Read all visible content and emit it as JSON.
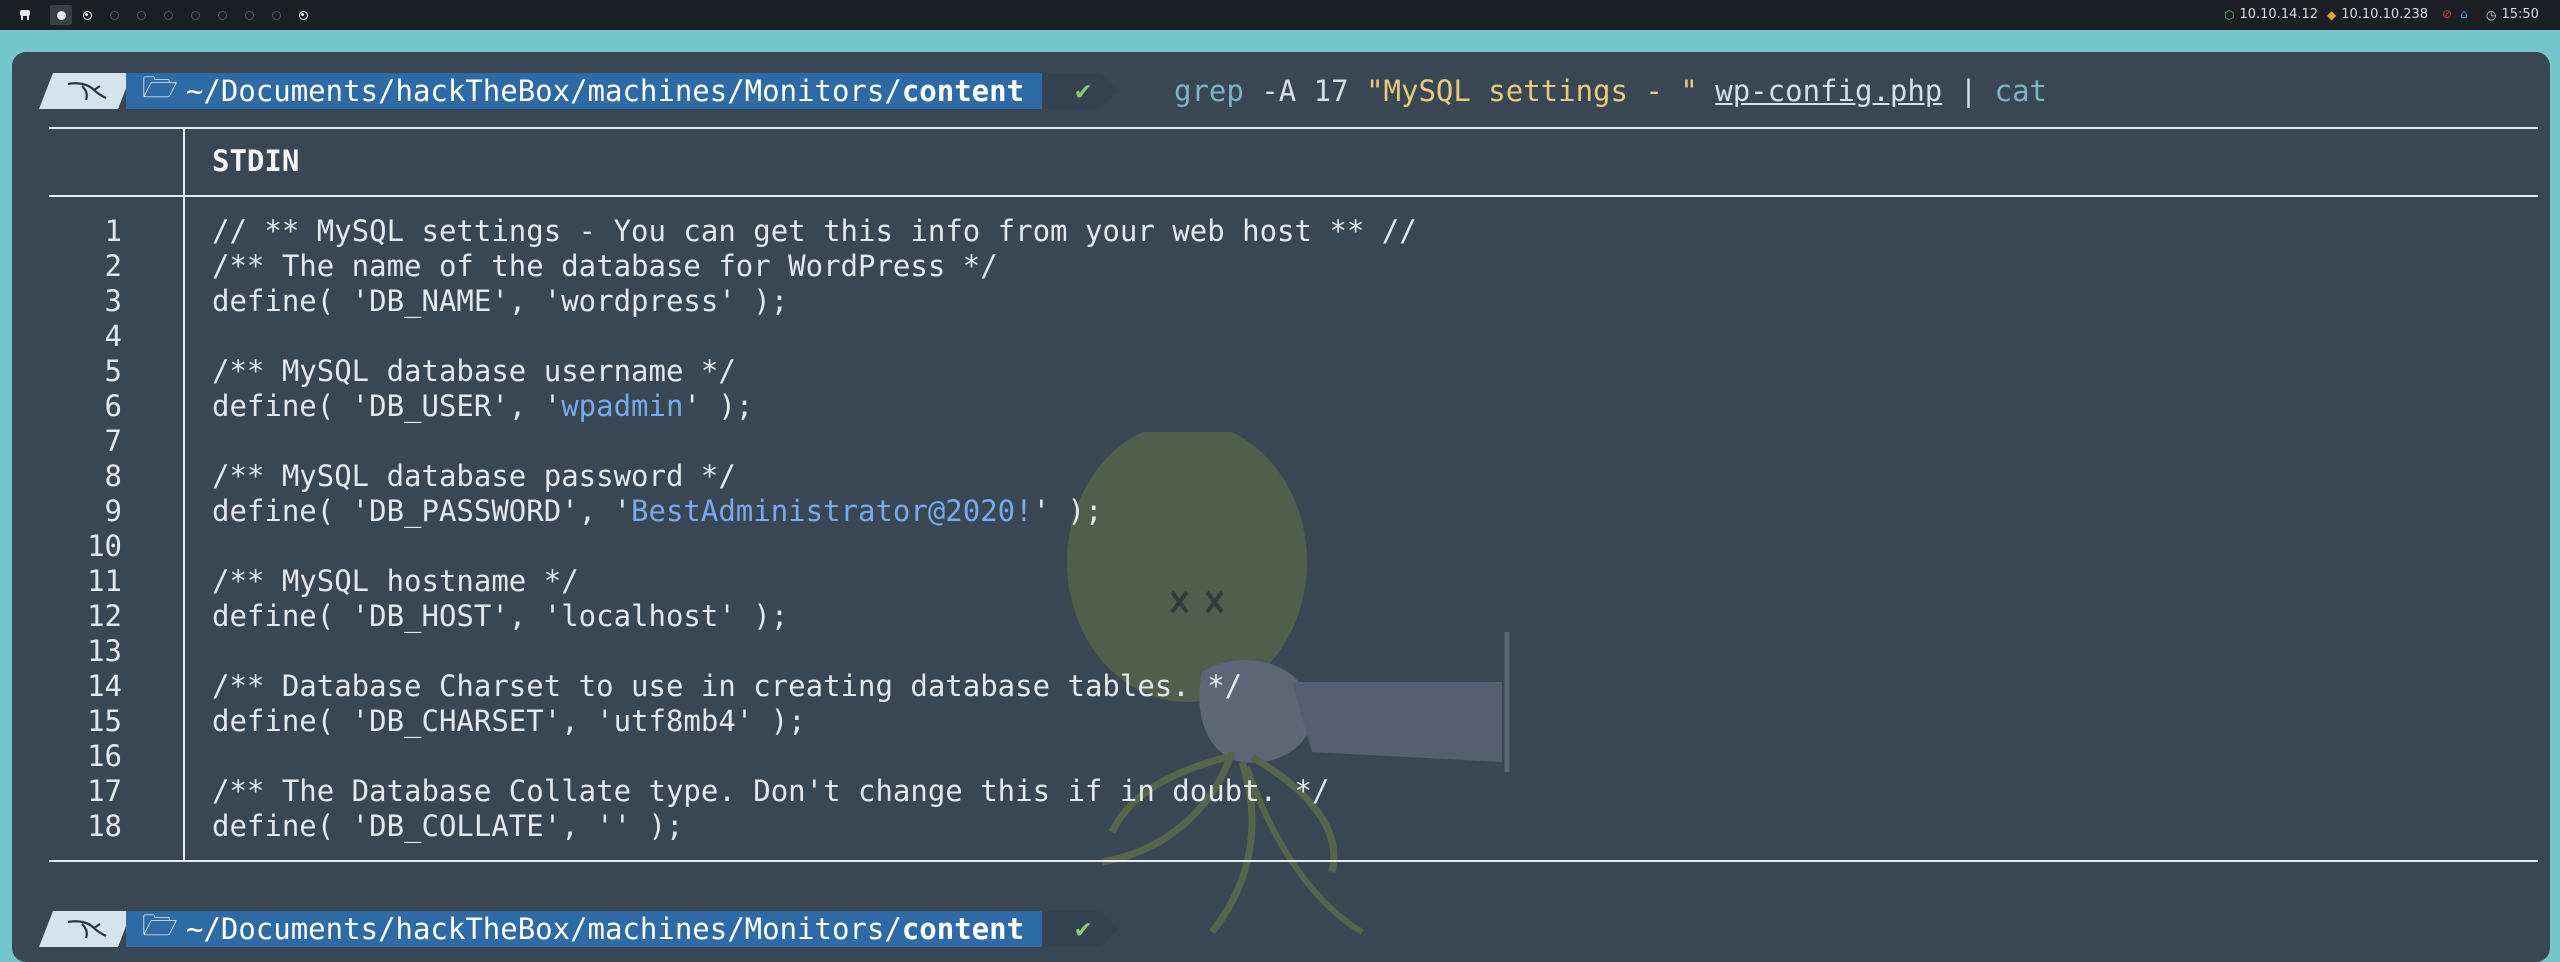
{
  "topbar": {
    "workspaces": [
      {
        "state": "active-full"
      },
      {
        "state": "ring-dot"
      },
      {
        "state": "empty"
      },
      {
        "state": "empty"
      },
      {
        "state": "empty"
      },
      {
        "state": "empty"
      },
      {
        "state": "empty"
      },
      {
        "state": "empty"
      },
      {
        "state": "empty"
      },
      {
        "state": "ring-dot"
      }
    ],
    "vpn_ip": "10.10.14.12",
    "target_ip": "10.10.10.238",
    "time": "15:50",
    "colors": {
      "vpn": "#48c774",
      "target": "#f0a020",
      "alert": "#e04040",
      "home": "#3b8fe0"
    }
  },
  "prompt": {
    "path_prefix": "~/Documents/hackTheBox/machines/Monitors/",
    "path_current": "content",
    "status_icon": "✔"
  },
  "command": {
    "cmd": "grep",
    "flag": " -A 17 ",
    "pattern": "\"MySQL settings - \"",
    "file": "wp-config.php",
    "pipe": " | ",
    "pipe_cmd": "cat"
  },
  "output": {
    "header": "STDIN",
    "lines": [
      {
        "n": "1",
        "text": "// ** MySQL settings - You can get this info from your web host ** //"
      },
      {
        "n": "2",
        "text": "/** The name of the database for WordPress */"
      },
      {
        "n": "3",
        "text": "define( 'DB_NAME', 'wordpress' );"
      },
      {
        "n": "4",
        "text": ""
      },
      {
        "n": "5",
        "text": "/** MySQL database username */"
      },
      {
        "n": "6",
        "pre": "define( 'DB_USER', '",
        "hl": "wpadmin",
        "post": "' );"
      },
      {
        "n": "7",
        "text": ""
      },
      {
        "n": "8",
        "text": "/** MySQL database password */"
      },
      {
        "n": "9",
        "pre": "define( 'DB_PASSWORD', '",
        "hl": "BestAdministrator@2020!",
        "post": "' );"
      },
      {
        "n": "10",
        "text": ""
      },
      {
        "n": "11",
        "text": "/** MySQL hostname */"
      },
      {
        "n": "12",
        "text": "define( 'DB_HOST', 'localhost' );"
      },
      {
        "n": "13",
        "text": ""
      },
      {
        "n": "14",
        "text": "/** Database Charset to use in creating database tables. */"
      },
      {
        "n": "15",
        "text": "define( 'DB_CHARSET', 'utf8mb4' );"
      },
      {
        "n": "16",
        "text": ""
      },
      {
        "n": "17",
        "text": "/** The Database Collate type. Don't change this if in doubt. */"
      },
      {
        "n": "18",
        "text": "define( 'DB_COLLATE', '' );"
      }
    ]
  }
}
